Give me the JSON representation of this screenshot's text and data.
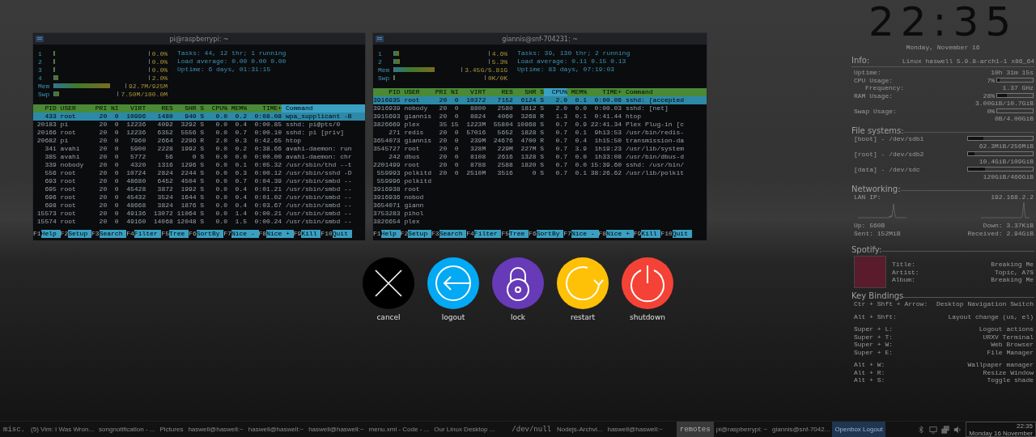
{
  "terminals": [
    {
      "title": "pi@raspberrypi: ~",
      "meters": [
        {
          "label": "1",
          "level": 0,
          "value": "0.0%"
        },
        {
          "label": "2",
          "level": 0,
          "value": "0.0%"
        },
        {
          "label": "3",
          "level": 0,
          "value": "0.0%"
        },
        {
          "label": "4",
          "level": 0.04,
          "value": "2.0%"
        },
        {
          "label": "Mem",
          "level": 0.78,
          "value": "92.7M/925M"
        },
        {
          "label": "Swp",
          "level": 0.08,
          "value": "7.50M/100.0M"
        }
      ],
      "info": [
        "Tasks: 44, 12 thr; 1 running",
        "Load average: 0.00 0.00 0.00",
        "Uptime: 6 days, 01:31:15"
      ],
      "columns": [
        {
          "label": "PID",
          "selected": false
        },
        {
          "label": "USER",
          "selected": false
        },
        {
          "label": "PRI",
          "selected": false
        },
        {
          "label": "NI",
          "selected": false
        },
        {
          "label": "VIRT",
          "selected": false
        },
        {
          "label": "RES",
          "selected": false
        },
        {
          "label": "SHR",
          "selected": false
        },
        {
          "label": "S",
          "selected": false
        },
        {
          "label": "CPU%",
          "selected": false
        },
        {
          "label": "MEM%",
          "selected": false
        },
        {
          "label": "TIME+",
          "selected": false
        },
        {
          "label": "Command",
          "selected": true
        }
      ],
      "rows": [
        {
          "selected": true,
          "cells": [
            "433",
            "root",
            "20",
            "0",
            "10996",
            "1480",
            "940",
            "S",
            "0.0",
            "0.2",
            "0:08.08",
            "wpa_supplicant -B"
          ]
        },
        {
          "selected": false,
          "cells": [
            "20183",
            "pi",
            "20",
            "0",
            "12236",
            "4092",
            "3292",
            "S",
            "0.0",
            "0.4",
            "0:00.85",
            "sshd: pi@pts/0"
          ]
        },
        {
          "selected": false,
          "cells": [
            "20166",
            "root",
            "20",
            "0",
            "12236",
            "6352",
            "5556",
            "S",
            "0.0",
            "0.7",
            "0:00.10",
            "sshd: pi [priv]"
          ]
        },
        {
          "selected": false,
          "cells": [
            "20682",
            "pi",
            "20",
            "0",
            "7960",
            "2664",
            "2296",
            "R",
            "2.0",
            "0.3",
            "0:42.65",
            "htop"
          ]
        },
        {
          "selected": false,
          "cells": [
            "341",
            "avahi",
            "20",
            "0",
            "5900",
            "2228",
            "1992",
            "S",
            "0.0",
            "0.2",
            "0:38.66",
            "avahi-daemon: run"
          ]
        },
        {
          "selected": false,
          "cells": [
            "385",
            "avahi",
            "20",
            "0",
            "5772",
            "56",
            "0",
            "S",
            "0.0",
            "0.0",
            "0:00.00",
            "avahi-daemon: chr"
          ]
        },
        {
          "selected": false,
          "cells": [
            "339",
            "nobody",
            "20",
            "0",
            "4320",
            "1316",
            "1296",
            "S",
            "0.0",
            "0.1",
            "0:05.32",
            "/usr/sbin/thd --t"
          ]
        },
        {
          "selected": false,
          "cells": [
            "556",
            "root",
            "20",
            "0",
            "10724",
            "2824",
            "2244",
            "S",
            "0.0",
            "0.3",
            "0:00.12",
            "/usr/sbin/sshd -D"
          ]
        },
        {
          "selected": false,
          "cells": [
            "693",
            "root",
            "20",
            "0",
            "48680",
            "6452",
            "4504",
            "S",
            "0.0",
            "0.7",
            "0:04.39",
            "/usr/sbin/smbd --"
          ]
        },
        {
          "selected": false,
          "cells": [
            "695",
            "root",
            "20",
            "0",
            "45428",
            "3872",
            "1992",
            "S",
            "0.0",
            "0.4",
            "0:01.21",
            "/usr/sbin/smbd --"
          ]
        },
        {
          "selected": false,
          "cells": [
            "696",
            "root",
            "20",
            "0",
            "45432",
            "3524",
            "1644",
            "S",
            "0.0",
            "0.4",
            "0:01.02",
            "/usr/sbin/smbd --"
          ]
        },
        {
          "selected": false,
          "cells": [
            "698",
            "root",
            "20",
            "0",
            "48668",
            "3824",
            "1876",
            "S",
            "0.0",
            "0.4",
            "0:03.67",
            "/usr/sbin/smbd --"
          ]
        },
        {
          "selected": false,
          "cells": [
            "15573",
            "root",
            "20",
            "0",
            "49136",
            "13072",
            "11064",
            "S",
            "0.0",
            "1.4",
            "0:00.21",
            "/usr/sbin/smbd --"
          ]
        },
        {
          "selected": false,
          "cells": [
            "15574",
            "root",
            "20",
            "0",
            "49160",
            "14068",
            "12048",
            "S",
            "0.0",
            "1.5",
            "0:00.24",
            "/usr/sbin/smbd --"
          ]
        }
      ],
      "fkeys": [
        {
          "key": "F1",
          "label": "Help"
        },
        {
          "key": "F2",
          "label": "Setup"
        },
        {
          "key": "F3",
          "label": "Search"
        },
        {
          "key": "F4",
          "label": "Filter"
        },
        {
          "key": "F5",
          "label": "Tree"
        },
        {
          "key": "F6",
          "label": "SortBy"
        },
        {
          "key": "F7",
          "label": "Nice -"
        },
        {
          "key": "F8",
          "label": "Nice +"
        },
        {
          "key": "F9",
          "label": "Kill"
        },
        {
          "key": "F10",
          "label": "Quit"
        }
      ]
    },
    {
      "title": "giannis@snf-704231: ~",
      "meters": [
        {
          "label": "1",
          "level": 0.05,
          "value": "4.6%"
        },
        {
          "label": "2",
          "level": 0.06,
          "value": "5.3%"
        },
        {
          "label": "Mem",
          "level": 0.6,
          "value": "3.45G/5.81G"
        },
        {
          "label": "Swp",
          "level": 0,
          "value": "0K/0K"
        }
      ],
      "info": [
        "Tasks: 39, 130 thr; 2 running",
        "Load average: 0.11 0.15 0.13",
        "Uptime: 83 days, 07:19:03"
      ],
      "columns": [
        {
          "label": "PID",
          "selected": false
        },
        {
          "label": "USER",
          "selected": false
        },
        {
          "label": "PRI",
          "selected": false
        },
        {
          "label": "NI",
          "selected": false
        },
        {
          "label": "VIRT",
          "selected": false
        },
        {
          "label": "RES",
          "selected": false
        },
        {
          "label": "SHR",
          "selected": false
        },
        {
          "label": "S",
          "selected": false
        },
        {
          "label": "CPU%",
          "selected": true
        },
        {
          "label": "MEM%",
          "selected": false
        },
        {
          "label": "TIME+",
          "selected": false
        },
        {
          "label": "Command",
          "selected": false
        }
      ],
      "rows": [
        {
          "selected": true,
          "cells": [
            "3916935",
            "root",
            "20",
            "0",
            "10372",
            "7152",
            "6124",
            "S",
            "2.0",
            "0.1",
            "0:00.06",
            "sshd: [accepted"
          ]
        },
        {
          "selected": false,
          "cells": [
            "3916939",
            "nobody",
            "20",
            "0",
            "8800",
            "2580",
            "1812",
            "S",
            "2.0",
            "0.0",
            "0:00.03",
            "sshd: [net]"
          ]
        },
        {
          "selected": false,
          "cells": [
            "3915693",
            "giannis",
            "20",
            "0",
            "8824",
            "4060",
            "3268",
            "R",
            "1.3",
            "0.1",
            "0:41.44",
            "htop"
          ]
        },
        {
          "selected": false,
          "cells": [
            "3826669",
            "plex",
            "35",
            "15",
            "1223M",
            "55804",
            "10868",
            "S",
            "0.7",
            "0.9",
            "22:41.34",
            "Plex Plug-in [c"
          ]
        },
        {
          "selected": false,
          "cells": [
            "271",
            "redis",
            "20",
            "0",
            "57016",
            "5652",
            "1828",
            "S",
            "0.7",
            "0.1",
            "9h13:53",
            "/usr/bin/redis-"
          ]
        },
        {
          "selected": false,
          "cells": [
            "3654073",
            "giannis",
            "20",
            "0",
            "239M",
            "24676",
            "4700",
            "R",
            "0.7",
            "0.4",
            "1h15:50",
            "transmission-da"
          ]
        },
        {
          "selected": false,
          "cells": [
            "3545727",
            "root",
            "20",
            "0",
            "328M",
            "229M",
            "227M",
            "S",
            "0.7",
            "3.9",
            "1h19:23",
            "/usr/lib/system"
          ]
        },
        {
          "selected": false,
          "cells": [
            "242",
            "dbus",
            "20",
            "0",
            "8108",
            "2616",
            "1328",
            "S",
            "0.7",
            "0.0",
            "1h33:08",
            "/usr/bin/dbus-d"
          ]
        },
        {
          "selected": false,
          "cells": [
            "2201499",
            "root",
            "20",
            "0",
            "8788",
            "2588",
            "1820",
            "S",
            "0.7",
            "0.0",
            "15:39.60",
            "sshd: /usr/bin/"
          ]
        },
        {
          "selected": false,
          "cells": [
            "559993",
            "polkitd",
            "20",
            "0",
            "2510M",
            "3516",
            "0",
            "S",
            "0.7",
            "0.1",
            "38:26.62",
            "/usr/lib/polkit"
          ]
        },
        {
          "selected": false,
          "cells": [
            "559996",
            "polkitd"
          ]
        },
        {
          "selected": false,
          "cells": [
            "3916938",
            "root"
          ]
        },
        {
          "selected": false,
          "cells": [
            "3916936",
            "nobod"
          ]
        },
        {
          "selected": false,
          "cells": [
            "3654071",
            "giann"
          ]
        },
        {
          "selected": false,
          "cells": [
            "3753283",
            "pihol"
          ]
        },
        {
          "selected": false,
          "cells": [
            "3826654",
            "plex"
          ]
        }
      ],
      "fkeys": [
        {
          "key": "F1",
          "label": "Help"
        },
        {
          "key": "F2",
          "label": "Setup"
        },
        {
          "key": "F3",
          "label": "Search"
        },
        {
          "key": "F4",
          "label": "Filter"
        },
        {
          "key": "F5",
          "label": "Tree"
        },
        {
          "key": "F6",
          "label": "SortBy"
        },
        {
          "key": "F7",
          "label": "Nice -"
        },
        {
          "key": "F8",
          "label": "Nice +"
        },
        {
          "key": "F9",
          "label": "Kill"
        },
        {
          "key": "F10",
          "label": "Quit"
        }
      ]
    }
  ],
  "conky": {
    "clock": "22:35",
    "date": "Monday, November 16",
    "sections": [
      {
        "kind": "list",
        "title": "Info:",
        "aside": "Linux haswell 5.9.8-arch1-1 x86_64",
        "rows": [
          {
            "kind": "text",
            "label": "Uptime:",
            "value": "10h 31m 15s"
          },
          {
            "kind": "bar",
            "label": "CPU Usage:",
            "value": "7%",
            "level": 0.07
          },
          {
            "kind": "sub",
            "label": "Frequency:",
            "value": "1.37 GHz"
          },
          {
            "kind": "bar",
            "label": "RAM Usage:",
            "value": "28%",
            "level": 0.28
          },
          {
            "kind": "value",
            "value": "3.00GiB/10.7GiB"
          },
          {
            "kind": "bar",
            "label": "Swap Usage:",
            "value": "0%",
            "level": 0
          },
          {
            "kind": "value",
            "value": "0B/4.00GiB"
          }
        ]
      },
      {
        "kind": "list",
        "title": "File systems:",
        "rows": [
          {
            "kind": "bar",
            "label": "[boot] - /dev/sdb1",
            "level": 0.24
          },
          {
            "kind": "value",
            "value": "62.3MiB/256MiB"
          },
          {
            "kind": "bar",
            "label": "[root] - /dev/sdb2",
            "level": 0.1
          },
          {
            "kind": "value",
            "value": "10.4GiB/109GiB"
          },
          {
            "kind": "bar",
            "label": "[data] - /dev/sdc",
            "level": 0.26
          },
          {
            "kind": "value",
            "value": "120GiB/466GiB"
          }
        ]
      },
      {
        "kind": "list",
        "title": "Networking:",
        "rows": [
          {
            "kind": "text",
            "label": "LAN IP:",
            "value": "192.168.2.2"
          },
          {
            "kind": "graphs"
          },
          {
            "kind": "text",
            "label": "Up: 560B",
            "value": "Down: 3.37KiB"
          },
          {
            "kind": "text",
            "label": "Sent: 152MiB",
            "value": "Received: 2.94GiB"
          }
        ]
      },
      {
        "kind": "media",
        "title": "Spotify:",
        "rows": [
          {
            "kind": "text",
            "label": "Title:",
            "value": "Breaking Me"
          },
          {
            "kind": "text",
            "label": "Artist:",
            "value": "Topic, A7S"
          },
          {
            "kind": "text",
            "label": "Album:",
            "value": "Breaking Me"
          }
        ]
      },
      {
        "kind": "list",
        "title": "Key Bindings",
        "rows": [
          {
            "kind": "text",
            "label": "Ctr + Shft + Arrow:",
            "value": "Desktop Navigation Switch"
          },
          {
            "kind": "gap"
          },
          {
            "kind": "text",
            "label": "Alt + Shft:",
            "value": "Layout change (us, el)"
          },
          {
            "kind": "gap"
          },
          {
            "kind": "text",
            "label": "Super + L:",
            "value": "Logout actions"
          },
          {
            "kind": "text",
            "label": "Super + T:",
            "value": "URXV Terminal"
          },
          {
            "kind": "text",
            "label": "Super + W:",
            "value": "Web Browser"
          },
          {
            "kind": "text",
            "label": "Super + E:",
            "value": "File Manager"
          },
          {
            "kind": "gap"
          },
          {
            "kind": "text",
            "label": "Alt + W:",
            "value": "Wallpaper manager"
          },
          {
            "kind": "text",
            "label": "Alt + R:",
            "value": "Resize Window"
          },
          {
            "kind": "text",
            "label": "Alt + S:",
            "value": "Toggle shade"
          }
        ]
      }
    ]
  },
  "logout_buttons": [
    {
      "kind": "cancel",
      "label": "cancel",
      "color": "#000000"
    },
    {
      "kind": "logout",
      "label": "logout",
      "color": "#03a9f4"
    },
    {
      "kind": "lock",
      "label": "lock",
      "color": "#673ab7"
    },
    {
      "kind": "restart",
      "label": "restart",
      "color": "#ffc107"
    },
    {
      "kind": "shutdown",
      "label": "shutdown",
      "color": "#f44336"
    }
  ],
  "taskbar": {
    "groups": [
      {
        "name": "misc.",
        "selected": false,
        "tasks": [
          {
            "label": "(5) Vim: I Was Wron...",
            "selected": false
          },
          {
            "label": "songnotification - ...",
            "selected": false
          },
          {
            "label": "Pictures",
            "selected": false
          },
          {
            "label": "haswell@haswell:~",
            "selected": false
          },
          {
            "label": "haswell@haswell:~",
            "selected": false
          },
          {
            "label": "haswell@haswell:~",
            "selected": false
          },
          {
            "label": "menu.xml - Code - ...",
            "selected": false
          },
          {
            "label": "Our Linux Desktop ...",
            "selected": false
          }
        ]
      },
      {
        "name": "/dev/null",
        "selected": false,
        "tasks": [
          {
            "label": "Nodejs-Archvi...",
            "selected": false
          },
          {
            "label": "haswell@haswell:~",
            "selected": false
          }
        ]
      },
      {
        "name": "remotes",
        "selected": true,
        "tasks": [
          {
            "label": "pi@raspberrypi: ~",
            "selected": false
          },
          {
            "label": "giannis@snf-7042...",
            "selected": false
          },
          {
            "label": "Openbox Logout",
            "selected": true
          }
        ]
      }
    ],
    "clock": {
      "time": "22:35",
      "date": "Monday 16 November"
    }
  }
}
